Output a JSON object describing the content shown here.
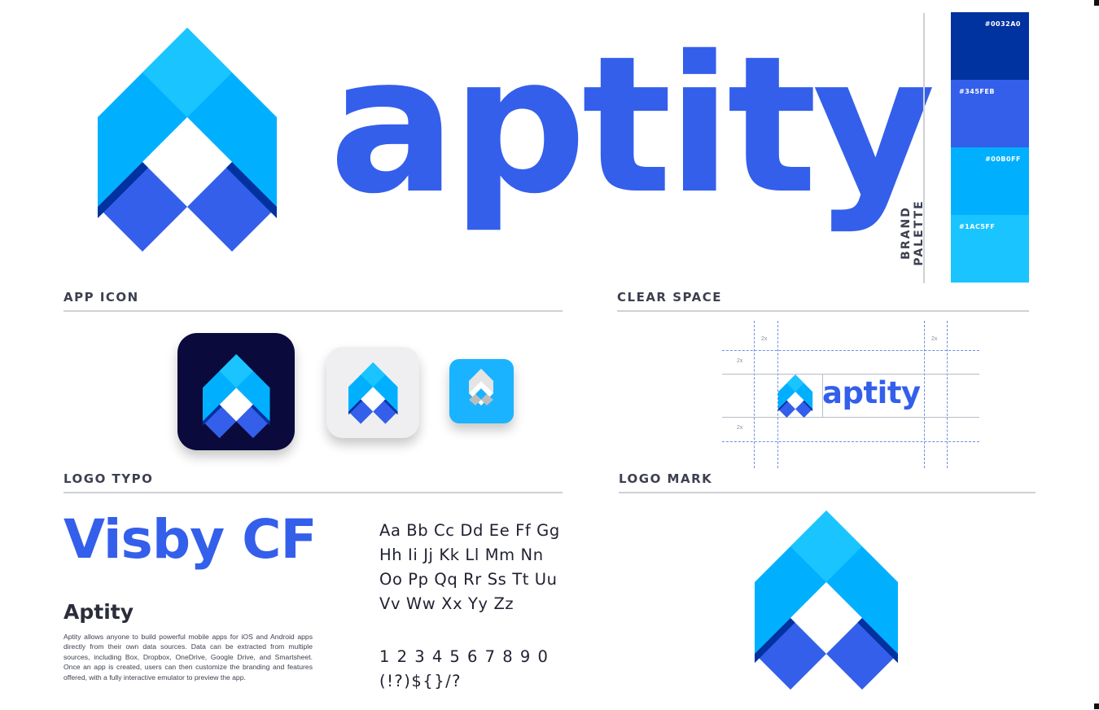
{
  "brand": {
    "wordmark": "aptity"
  },
  "palette": {
    "label": "BRAND PALETTE",
    "swatches": [
      {
        "hex": "#0032A0",
        "label": "#0032A0"
      },
      {
        "hex": "#345FEB",
        "label": "#345FEB"
      },
      {
        "hex": "#00B0FF",
        "label": "#00B0FF"
      },
      {
        "hex": "#1AC5FF",
        "label": "#1AC5FF"
      }
    ]
  },
  "sections": {
    "app_icon": "APP ICON",
    "clear_space": "CLEAR SPACE",
    "logo_typo": "LOGO TYPO",
    "logo_mark": "LOGO MARK"
  },
  "clear_space": {
    "wordmark": "aptity",
    "unit_label": "2x"
  },
  "typography": {
    "font_name": "Visby CF",
    "brand_name": "Aptity",
    "description": "Aptity allows anyone to build powerful mobile apps for iOS and Android apps directly from their own data sources. Data can be extracted from multiple sources, including Box, Dropbox, OneDrive, Google Drive, and Smartsheet. Once an app is created, users can then customize the branding and features offered, with a fully interactive emulator to preview the app.",
    "alphabet_lines": [
      "Aa Bb Cc Dd Ee Ff Gg",
      "Hh Ii Jj Kk Ll Mm Nn",
      "Oo Pp Qq Rr Ss Tt Uu",
      "Vv Ww Xx Yy Zz"
    ],
    "numerals": "1 2 3 4 5 6 7 8 9 0",
    "symbols": "(!?)${}/?"
  },
  "icons": [
    "aptity-logo-mark-icon",
    "app-icon-dark",
    "app-icon-light",
    "app-icon-blue"
  ]
}
